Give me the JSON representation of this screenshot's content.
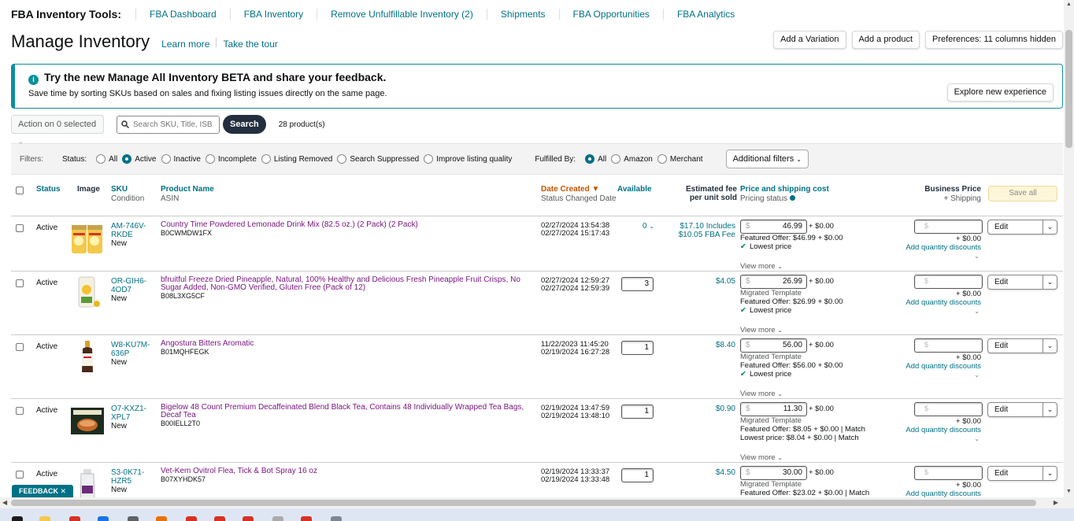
{
  "topnav": {
    "lead": "FBA Inventory Tools:",
    "links": [
      "FBA Dashboard",
      "FBA Inventory",
      "Remove Unfulfillable Inventory (2)",
      "Shipments",
      "FBA Opportunities",
      "FBA Analytics"
    ]
  },
  "header": {
    "title": "Manage Inventory",
    "learn_more": "Learn more",
    "take_tour": "Take the tour",
    "add_variation": "Add a Variation",
    "add_product": "Add a product",
    "preferences": "Preferences: 11 columns hidden"
  },
  "banner": {
    "icon": "info-icon",
    "title": "Try the new Manage All Inventory BETA and share your feedback.",
    "subtitle": "Save time by sorting SKUs based on sales and fixing listing issues directly on the same page.",
    "button": "Explore new experience"
  },
  "actions": {
    "action_select": "Action on 0 selected",
    "search_placeholder": "Search SKU, Title, ISBN",
    "search_button": "Search",
    "count": "28 product(s)"
  },
  "filters": {
    "label": "Filters:",
    "status_label": "Status:",
    "status_options": [
      "All",
      "Active",
      "Inactive",
      "Incomplete",
      "Listing Removed",
      "Search Suppressed",
      "Improve listing quality"
    ],
    "status_selected": "Active",
    "fulfilled_label": "Fulfilled By:",
    "fulfilled_options": [
      "All",
      "Amazon",
      "Merchant"
    ],
    "fulfilled_selected": "All",
    "additional": "Additional filters"
  },
  "table": {
    "headers": {
      "status": "Status",
      "image": "Image",
      "sku": "SKU",
      "sku_sub": "Condition",
      "product": "Product Name",
      "product_sub": "ASIN",
      "date": "Date Created",
      "date_sub": "Status Changed Date",
      "available": "Available",
      "fee": "Estimated fee per unit sold",
      "price": "Price and shipping cost",
      "price_sub": "Pricing status",
      "business": "Business Price",
      "business_sub": "+ Shipping",
      "save_all": "Save all"
    },
    "rows": [
      {
        "status": "Active",
        "sku1": "AM-746V-",
        "sku2": "RKDE",
        "condition": "New",
        "name": "Country Time Powdered Lemonade Drink Mix (82.5 oz.) (2 Pack) (2 Pack)",
        "asin": "B0CWMDW1FX",
        "created": "02/27/2024 13:54:38",
        "changed": "02/27/2024 15:17:43",
        "available": "0",
        "fee1": "$17.10 Includes",
        "fee2": "$10.05 FBA Fee",
        "price": "46.99",
        "shipping": "+ $0.00",
        "lines": [
          "Featured Offer: $46.99 + $0.00"
        ],
        "lowest": "Lowest price",
        "view_more": "View more",
        "biz_ship": "+ $0.00",
        "aqd": "Add quantity discounts",
        "edit": "Edit"
      },
      {
        "status": "Active",
        "sku1": "OR-GIH6-",
        "sku2": "4OD7",
        "condition": "New",
        "name": "bfruitful Freeze Dried Pineapple, Natural, 100% Healthy and Delicious Fresh Pineapple Fruit Crisps, No Sugar Added, Non-GMO Verified, Gluten Free (Pack of 12)",
        "asin": "B08L3XG5CF",
        "created": "02/27/2024 12:59:27",
        "changed": "02/27/2024 12:59:39",
        "available": "3",
        "fee1": "$4.05",
        "fee2": "",
        "price": "26.99",
        "shipping": "+ $0.00",
        "lines": [
          "Migrated Template",
          "Featured Offer: $26.99 + $0.00"
        ],
        "lowest": "Lowest price",
        "view_more": "View more",
        "biz_ship": "+ $0.00",
        "aqd": "Add quantity discounts",
        "edit": "Edit"
      },
      {
        "status": "Active",
        "sku1": "W8-KU7M-",
        "sku2": "636P",
        "condition": "New",
        "name": "Angostura Bitters Aromatic",
        "asin": "B01MQHFEGK",
        "created": "11/22/2023 11:45:20",
        "changed": "02/19/2024 16:27:28",
        "available": "1",
        "fee1": "$8.40",
        "fee2": "",
        "price": "56.00",
        "shipping": "+ $0.00",
        "lines": [
          "Migrated Template",
          "Featured Offer: $56.00 + $0.00"
        ],
        "lowest": "Lowest price",
        "view_more": "View more",
        "biz_ship": "+ $0.00",
        "aqd": "Add quantity discounts",
        "edit": "Edit"
      },
      {
        "status": "Active",
        "sku1": "O7-KXZ1-",
        "sku2": "XPL7",
        "condition": "New",
        "name": "Bigelow 48 Count Premium Decaffeinated Blend Black Tea, Contains 48 Individually Wrapped Tea Bags, Decaf Tea",
        "asin": "B00IELL2T0",
        "created": "02/19/2024 13:47:59",
        "changed": "02/19/2024 13:48:10",
        "available": "1",
        "fee1": "$0.90",
        "fee2": "",
        "price": "11.30",
        "shipping": "+ $0.00",
        "lines": [
          "Migrated Template",
          "Featured Offer: $8.05 + $0.00 | Match",
          "Lowest price: $8.04 + $0.00 | Match"
        ],
        "lowest": "",
        "view_more": "View more",
        "biz_ship": "+ $0.00",
        "aqd": "Add quantity discounts",
        "edit": "Edit"
      },
      {
        "status": "Active",
        "sku1": "S3-0K71-",
        "sku2": "HZR5",
        "condition": "New",
        "name": "Vet-Kem Ovitrol Flea, Tick & Bot Spray 16 oz",
        "asin": "B07XYHDK57",
        "created": "02/19/2024 13:33:37",
        "changed": "02/19/2024 13:33:48",
        "available": "1",
        "fee1": "$4.50",
        "fee2": "",
        "price": "30.00",
        "shipping": "+ $0.00",
        "lines": [
          "Migrated Template",
          "Featured Offer: $23.02 + $0.00 | Match"
        ],
        "lowest": "",
        "view_more": "",
        "biz_ship": "+ $0.00",
        "aqd": "Add quantity discounts",
        "edit": "Edit"
      }
    ]
  },
  "feedback": "FEEDBACK ✕",
  "currency_symbol": "$",
  "colors": {
    "link": "#007185",
    "product_name": "#7a1780",
    "banner_accent": "#0d8fa0",
    "search_button": "#232f3e"
  }
}
